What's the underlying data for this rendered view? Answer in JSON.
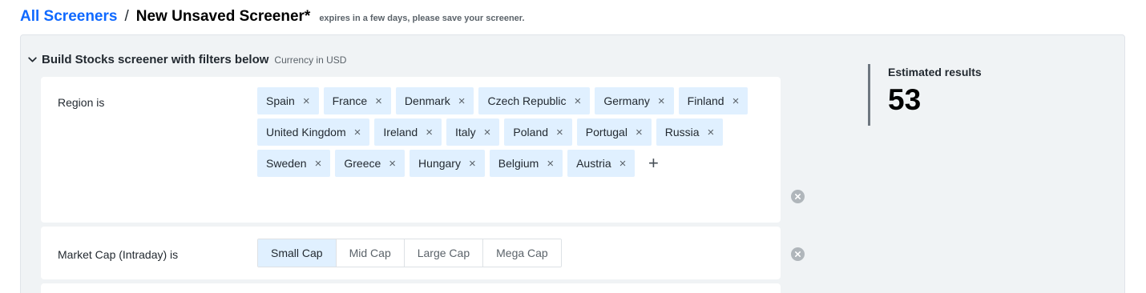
{
  "breadcrumb": {
    "root": "All Screeners",
    "separator": "/",
    "current": "New Unsaved Screener*",
    "note": "expires in a few days, please save your screener."
  },
  "builder": {
    "title": "Build Stocks screener with filters below",
    "currency": "Currency in USD"
  },
  "filters": {
    "region": {
      "label": "Region  is",
      "chips": [
        "Spain",
        "France",
        "Denmark",
        "Czech Republic",
        "Germany",
        "Finland",
        "United Kingdom",
        "Ireland",
        "Italy",
        "Poland",
        "Portugal",
        "Russia",
        "Sweden",
        "Greece",
        "Hungary",
        "Belgium",
        "Austria"
      ],
      "chip_remove_glyph": "×",
      "add_glyph": "+"
    },
    "market_cap": {
      "label": "Market Cap (Intraday)  is",
      "options": [
        {
          "label": "Small Cap",
          "selected": true
        },
        {
          "label": "Mid Cap",
          "selected": false
        },
        {
          "label": "Large Cap",
          "selected": false
        },
        {
          "label": "Mega Cap",
          "selected": false
        }
      ]
    }
  },
  "estimate": {
    "label": "Estimated results",
    "value": "53"
  },
  "colors": {
    "link": "#0f69ff",
    "chip_bg": "#e0f0ff",
    "panel_bg": "#f0f3f5"
  },
  "icons": {
    "collapse": "chevron-down-icon",
    "remove_filter": "close-circle-icon"
  }
}
